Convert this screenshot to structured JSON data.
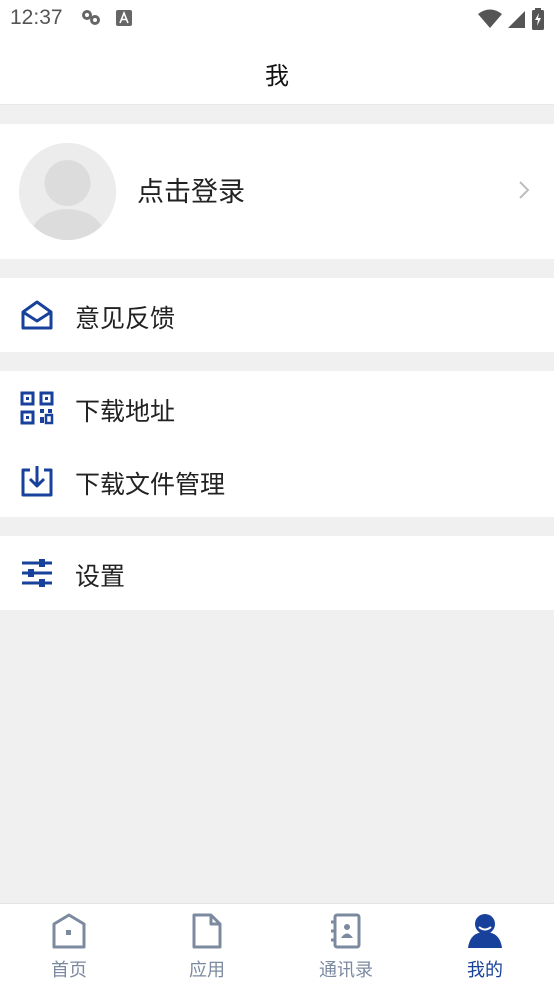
{
  "status_bar": {
    "time": "12:37",
    "left_icons": [
      "notification-icon",
      "font-a-icon"
    ],
    "right_icons": [
      "wifi-icon",
      "signal-icon",
      "battery-icon"
    ]
  },
  "header": {
    "title": "我"
  },
  "profile": {
    "login_label": "点击登录"
  },
  "menu": {
    "feedback": "意见反馈",
    "download_address": "下载地址",
    "download_files": "下载文件管理",
    "settings": "设置"
  },
  "tabs": [
    {
      "label": "首页",
      "icon": "home-icon",
      "active": false
    },
    {
      "label": "应用",
      "icon": "app-document-icon",
      "active": false
    },
    {
      "label": "通讯录",
      "icon": "contacts-book-icon",
      "active": false
    },
    {
      "label": "我的",
      "icon": "user-profile-icon",
      "active": true
    }
  ],
  "colors": {
    "accent": "#17419a",
    "inactive": "#7c8aa0",
    "background": "#f0f0f0"
  }
}
